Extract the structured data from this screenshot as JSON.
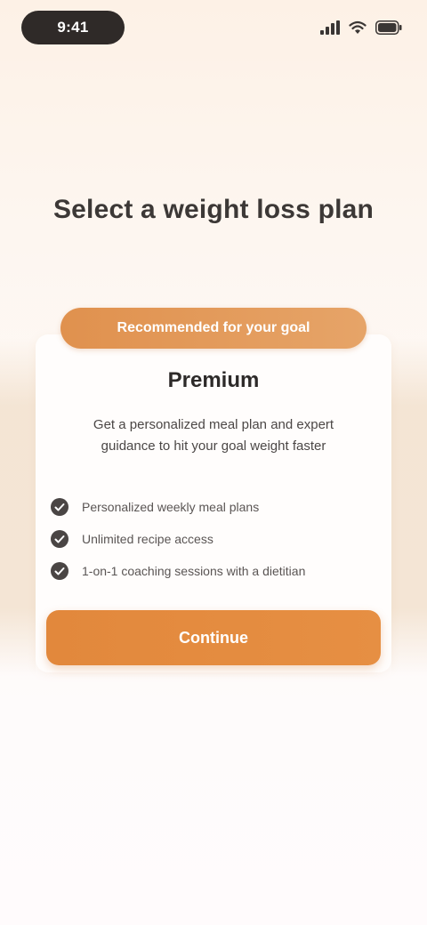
{
  "status_bar": {
    "time": "9:41",
    "icons": [
      "signal-icon",
      "wifi-icon",
      "battery-icon"
    ]
  },
  "headline": "Select a weight loss plan",
  "plan": {
    "ribbon_label": "Recommended for your goal",
    "name": "Premium",
    "description": "Get a personalized meal plan and expert guidance to hit your goal weight faster",
    "features": [
      "Personalized weekly meal plans",
      "Unlimited recipe access",
      "1-on-1 coaching sessions with a dietitian"
    ]
  },
  "cta": {
    "label": "Continue"
  },
  "colors": {
    "accent": "#e2883c",
    "ribbon": "#e0914e",
    "background": "#fdf4ec",
    "text": "#2d2a29"
  }
}
